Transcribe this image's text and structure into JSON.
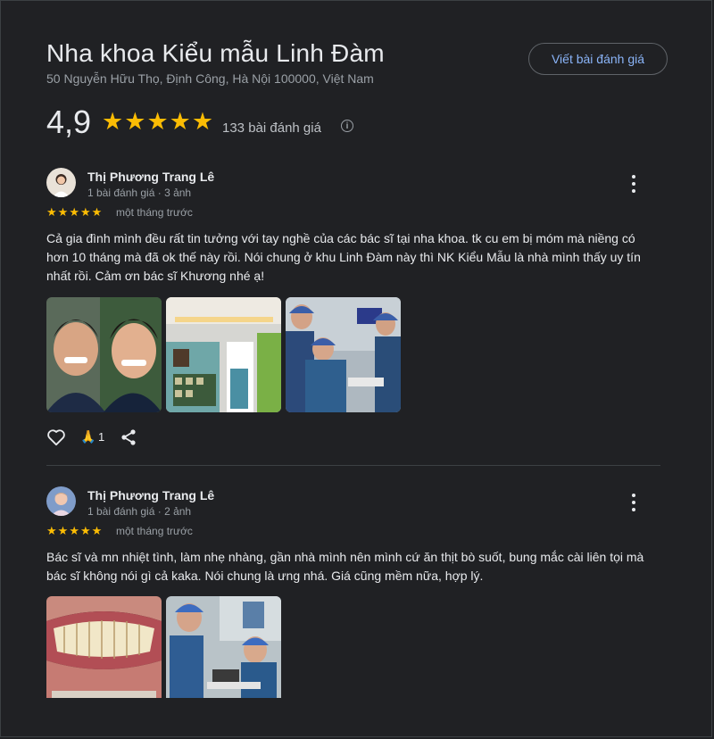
{
  "business": {
    "name": "Nha khoa Kiểu mẫu Linh Đàm",
    "address": "50 Nguyễn Hữu Thọ, Định Công, Hà Nội 100000, Việt Nam",
    "write_review_label": "Viết bài đánh giá",
    "rating": "4,9",
    "stars": 5,
    "review_count_label": "133 bài đánh giá",
    "info_icon": "i"
  },
  "reviews": [
    {
      "name": "Thị Phương Trang Lê",
      "meta": "1 bài đánh giá · 3 ảnh",
      "stars": 5,
      "time": "một tháng trước",
      "text": "Cả gia đình mình đều rất tin tưởng với tay nghề của các bác sĩ tại nha khoa. tk cu em bị móm mà niềng có hơn 10 tháng mà đã ok thế này rồi. Nói chung ở khu Linh Đàm này thì NK Kiểu Mẫu là nhà mình thấy uy tín nhất rồi. Cảm ơn bác sĩ Khương nhé ạ!",
      "photos": [
        "two-boys-smiling-photo",
        "clinic-interior-photo",
        "dentist-treatment-photo"
      ],
      "reaction_count": "1",
      "reaction_emoji": "🙏"
    },
    {
      "name": "Thị Phương Trang Lê",
      "meta": "1 bài đánh giá · 2 ảnh",
      "stars": 5,
      "time": "một tháng trước",
      "text": "Bác sĩ và mn nhiệt tình, làm nhẹ nhàng, gần nhà mình nên mình cứ ăn thịt bò suốt, bung mắc cài liên tọi mà bác sĩ không nói gì cả kaka. Nói chung là ưng nhá. Giá cũng mềm nữa, hợp lý.",
      "photos": [
        "teeth-closeup-photo",
        "dental-procedure-photo"
      ]
    }
  ],
  "colors": {
    "background": "#202124",
    "star": "#fbbc04",
    "link": "#8ab4f8",
    "muted": "#9aa0a6"
  }
}
